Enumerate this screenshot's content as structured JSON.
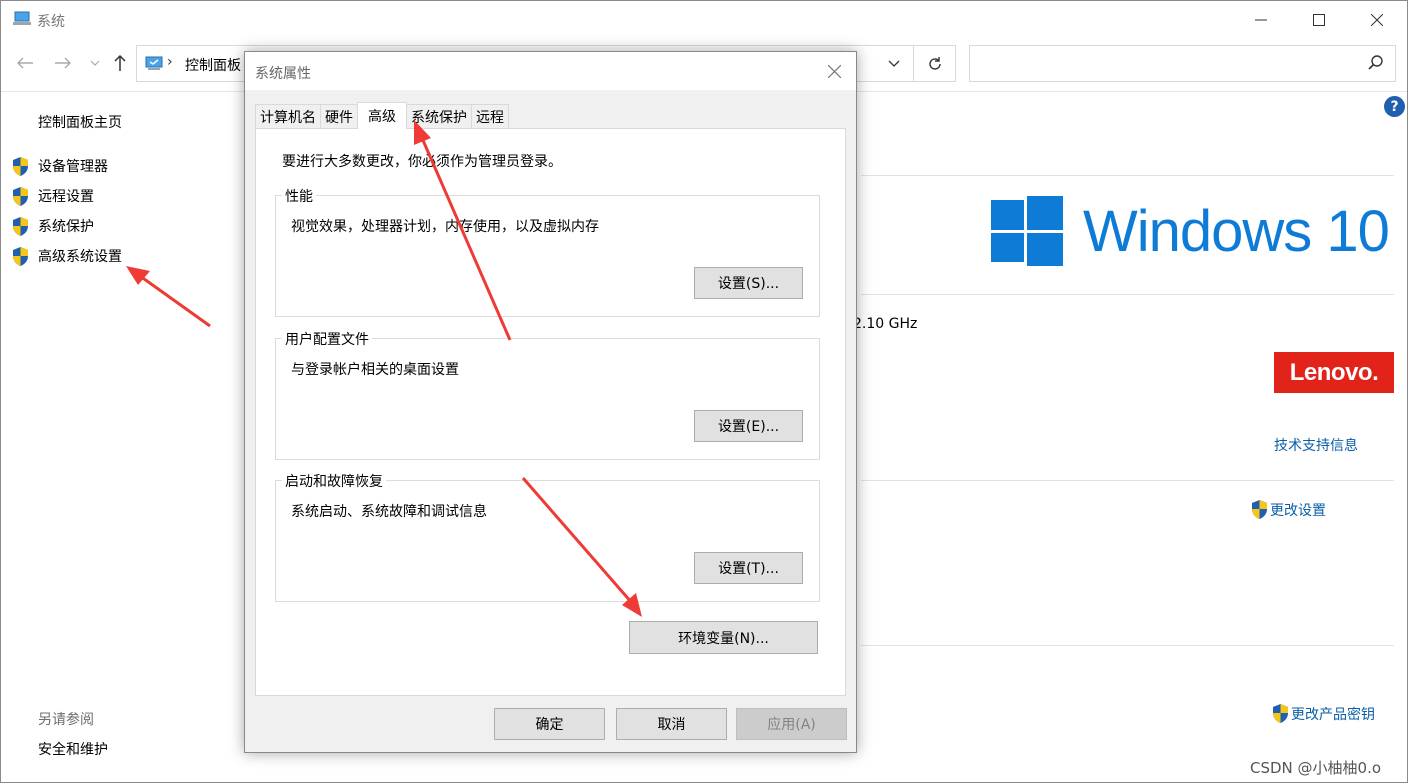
{
  "window": {
    "title": "系统"
  },
  "navbar": {
    "breadcrumb": "控制面板"
  },
  "left_pane": {
    "home": "控制面板主页",
    "items": [
      {
        "label": "设备管理器"
      },
      {
        "label": "远程设置"
      },
      {
        "label": "系统保护"
      },
      {
        "label": "高级系统设置"
      }
    ],
    "see_also": "另请参阅",
    "security": "安全和维护"
  },
  "content": {
    "windows_logo_text": "Windows 10",
    "cpu_speed": "2.10 GHz",
    "oem_logo_text": "Lenovo.",
    "tech_support": "技术支持信息",
    "change_settings": "更改设置",
    "change_product_key": "更改产品密钥"
  },
  "dialog": {
    "title": "系统属性",
    "tabs": [
      {
        "label": "计算机名"
      },
      {
        "label": "硬件"
      },
      {
        "label": "高级"
      },
      {
        "label": "系统保护"
      },
      {
        "label": "远程"
      }
    ],
    "active_tab": "高级",
    "note": "要进行大多数更改，你必须作为管理员登录。",
    "groups": [
      {
        "title": "性能",
        "desc": "视觉效果，处理器计划，内存使用，以及虚拟内存",
        "button": "设置(S)..."
      },
      {
        "title": "用户配置文件",
        "desc": "与登录帐户相关的桌面设置",
        "button": "设置(E)..."
      },
      {
        "title": "启动和故障恢复",
        "desc": "系统启动、系统故障和调试信息",
        "button": "设置(T)..."
      }
    ],
    "env_button": "环境变量(N)...",
    "ok": "确定",
    "cancel": "取消",
    "apply": "应用(A)"
  },
  "watermark": "CSDN @小柚柚0.o",
  "colors": {
    "accent": "#0e7cd6",
    "link": "#0b5ea7",
    "arrow": "#ee3b35",
    "oem": "#e2231a"
  }
}
